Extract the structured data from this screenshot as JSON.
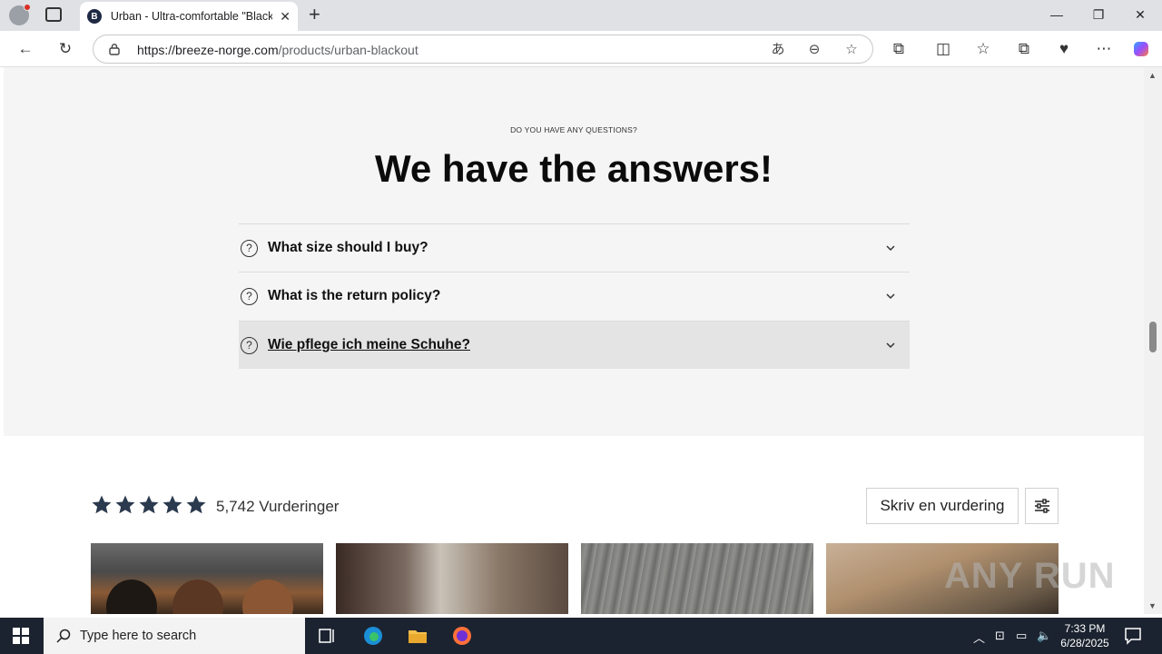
{
  "browser": {
    "tab_title": "Urban - Ultra-comfortable \"Black",
    "favicon_letter": "B",
    "url_domain": "https://breeze-norge.com",
    "url_path": "/products/urban-blackout"
  },
  "faq": {
    "eyebrow": "DO YOU HAVE ANY QUESTIONS?",
    "headline": "We have the answers!",
    "items": [
      {
        "question": "What size should I buy?"
      },
      {
        "question": "What is the return policy?"
      },
      {
        "question": "Wie pflege ich meine Schuhe?"
      }
    ]
  },
  "reviews": {
    "rating": 5,
    "count_text": "5,742 Vurderinger",
    "write_button": "Skriv en vurdering",
    "star_color": "#2b3a4e"
  },
  "taskbar": {
    "search_placeholder": "Type here to search",
    "time": "7:33 PM",
    "date": "6/28/2025"
  },
  "watermark": "ANY RUN"
}
